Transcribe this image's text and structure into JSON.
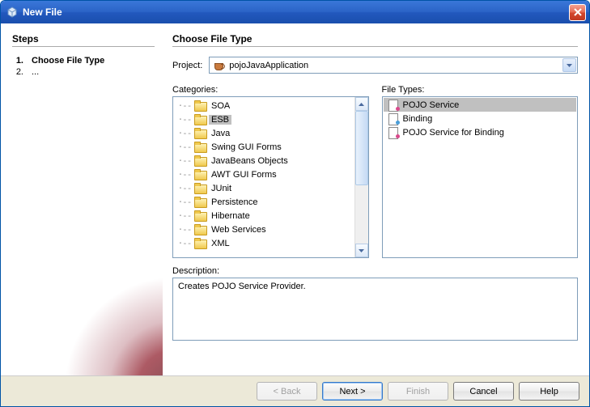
{
  "window": {
    "title": "New File"
  },
  "sidebar": {
    "heading": "Steps",
    "items": [
      {
        "num": "1.",
        "label": "Choose File Type",
        "bold": true
      },
      {
        "num": "2.",
        "label": "...",
        "bold": false
      }
    ]
  },
  "main": {
    "heading": "Choose File Type",
    "projectLabel": "Project:",
    "projectValue": "pojoJavaApplication",
    "categoriesLabel": "Categories:",
    "fileTypesLabel": "File Types:",
    "descriptionLabel": "Description:",
    "descriptionText": "Creates POJO Service Provider."
  },
  "categories": [
    "SOA",
    "ESB",
    "Java",
    "Swing GUI Forms",
    "JavaBeans Objects",
    "AWT GUI Forms",
    "JUnit",
    "Persistence",
    "Hibernate",
    "Web Services",
    "XML"
  ],
  "selectedCategory": "ESB",
  "fileTypes": [
    {
      "label": "POJO Service",
      "color": "#d94a8c"
    },
    {
      "label": "Binding",
      "color": "#4a9ed9"
    },
    {
      "label": "POJO Service for Binding",
      "color": "#d94a8c"
    }
  ],
  "selectedFileType": "POJO Service",
  "buttons": {
    "back": "< Back",
    "next": "Next >",
    "finish": "Finish",
    "cancel": "Cancel",
    "help": "Help"
  }
}
